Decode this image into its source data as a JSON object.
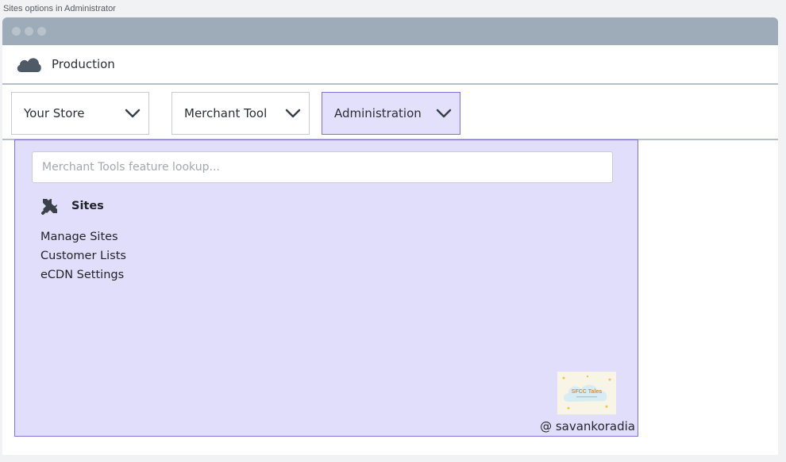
{
  "caption": "Sites options in Administrator",
  "environment": {
    "label": "Production",
    "icon": "cloud-icon"
  },
  "menus": [
    {
      "label": "Your Store",
      "active": false
    },
    {
      "label": "Merchant Tool",
      "active": false
    },
    {
      "label": "Administration",
      "active": true
    }
  ],
  "panel": {
    "search_placeholder": "Merchant Tools feature lookup...",
    "section": {
      "title": "Sites",
      "icon": "tools-icon"
    },
    "links": [
      "Manage Sites",
      "Customer Lists",
      "eCDN Settings"
    ],
    "badge_text": "SFCC Tales",
    "watermark": "@ savankoradia"
  },
  "colors": {
    "titlebar": "#9eabb8",
    "accent_border": "#7e72d6",
    "panel_bg": "#e0defb"
  }
}
